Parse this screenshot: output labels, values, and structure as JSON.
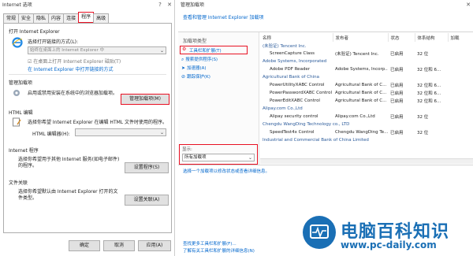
{
  "left": {
    "title": "Internet 选项",
    "help": "?",
    "close": "✕",
    "tabs": [
      "常规",
      "安全",
      "隐私",
      "内容",
      "连接",
      "程序",
      "高级"
    ],
    "active_tab": 5,
    "open_ie": {
      "heading": "打开 Internet Explorer",
      "desc": "选择打开链接的方式(L):",
      "combo": "始终在桌面上的 Internet Explorer 中",
      "checkbox": "☑ 在桌面上打开 Internet Explorer 磁贴(T)",
      "link": "在 Internet Explorer 中打开链接的方式"
    },
    "addons": {
      "heading": "管理加载项",
      "desc": "启用或禁用安装在系统中的浏览器加载项。",
      "button": "管理加载项(M)"
    },
    "html": {
      "heading": "HTML 编辑",
      "desc": "选择你希望 Internet Explorer 在编辑 HTML 文件时使用的程序。",
      "label": "HTML 编辑器(H):",
      "combo": ""
    },
    "internet_programs": {
      "heading": "Internet 程序",
      "desc": "选择你希望用于其他 Internet 服务(如电子邮件)的程序。",
      "button": "设置程序(S)"
    },
    "file_assoc": {
      "heading": "文件关联",
      "desc": "选择你希望默认由 Internet Explorer 打开的文件类型。",
      "button": "设置关联(A)"
    },
    "footer": {
      "ok": "确定",
      "cancel": "取消",
      "apply": "应用(A)"
    }
  },
  "right": {
    "title": "管理加载项",
    "close": "✕",
    "header_link": "查看和管理 Internet Explorer 加载项",
    "types_label": "加载项类型",
    "types": [
      "工具栏和扩展(T)",
      "搜索提供程序(S)",
      "加速器(A)",
      "跟踪保护(K)"
    ],
    "show_label": "显示:",
    "show_value": "所有加载项",
    "columns": [
      "名称",
      "发布者",
      "状态",
      "体系结构",
      "加载"
    ],
    "rows": [
      {
        "kind": "group",
        "name": "(未验证) Tencent Inc."
      },
      {
        "kind": "item",
        "name": "ScreenCapture Class",
        "publisher": "(未验证) Tencent Inc.",
        "status": "已启用",
        "arch": "32 位",
        "load": ""
      },
      {
        "kind": "group",
        "name": "Adobe Systems, Incorporated"
      },
      {
        "kind": "item",
        "name": "Adobe PDF Reader",
        "publisher": "Adobe Systems, Incorp...",
        "status": "已启用",
        "arch": "32 位和 6...",
        "load": ""
      },
      {
        "kind": "group",
        "name": "Agricultural Bank of China"
      },
      {
        "kind": "item",
        "name": "PowerUtilityXABC Control",
        "publisher": "Agricultural Bank of C...",
        "status": "已启用",
        "arch": "32 位和 6...",
        "load": ""
      },
      {
        "kind": "item",
        "name": "PowerPasswordXABC Control",
        "publisher": "Agricultural Bank of C...",
        "status": "已启用",
        "arch": "32 位和 6...",
        "load": ""
      },
      {
        "kind": "item",
        "name": "PowerEditXABC Control",
        "publisher": "Agricultural Bank of C...",
        "status": "已启用",
        "arch": "32 位和 6...",
        "load": ""
      },
      {
        "kind": "group",
        "name": "Alipay.com Co.,Ltd"
      },
      {
        "kind": "item",
        "name": "Alipay security control",
        "publisher": "Alipay.com Co.,Ltd",
        "status": "已启用",
        "arch": "32 位",
        "load": ""
      },
      {
        "kind": "group",
        "name": "Chengdu WangDing Technology co., LTD"
      },
      {
        "kind": "item",
        "name": "SpeedTest4x Control",
        "publisher": "Chengdu WangDing Te...",
        "status": "已启用",
        "arch": "32 位",
        "load": ""
      },
      {
        "kind": "group",
        "name": "Industrial and Commercial Bank of China Limited"
      }
    ],
    "details_hint": "选择一个加载项以修改状态或查看详细信息。",
    "bottom_links": [
      "查找更多工具栏和扩展(F)...",
      "了解有关工具栏和扩展的详细信息(N)"
    ]
  },
  "watermark": {
    "brand": "电脑百科知识",
    "url": "www.pc-daily.com"
  }
}
